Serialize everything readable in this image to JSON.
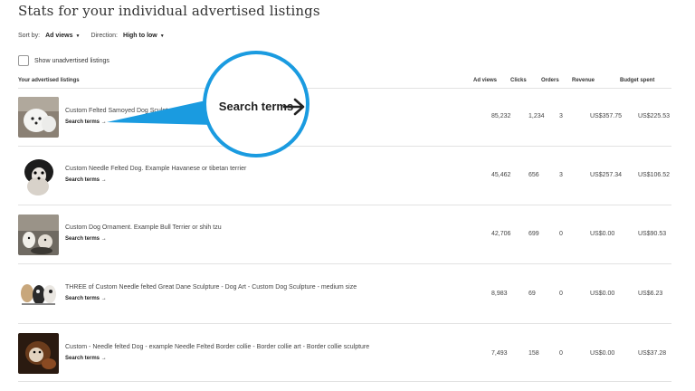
{
  "page": {
    "title": "Stats for your individual advertised listings"
  },
  "controls": {
    "sort_label": "Sort by:",
    "sort_value": "Ad views",
    "direction_label": "Direction:",
    "direction_value": "High to low",
    "show_unadvertised": "Show unadvertised listings"
  },
  "table": {
    "headers": {
      "listings": "Your advertised listings",
      "views": "Ad views",
      "clicks": "Clicks",
      "orders": "Orders",
      "revenue": "Revenue",
      "budget": "Budget spent"
    },
    "search_terms": "Search terms",
    "rows": [
      {
        "title": "Custom Felted Samoyed Dog Sculpture.",
        "views": "85,232",
        "clicks": "1,234",
        "orders": "3",
        "revenue": "US$357.75",
        "budget": "US$225.53"
      },
      {
        "title": "Custom Needle Felted Dog. Example Havanese or tibetan terrier",
        "views": "45,462",
        "clicks": "656",
        "orders": "3",
        "revenue": "US$257.34",
        "budget": "US$106.52"
      },
      {
        "title": "Custom Dog Ornament. Example Bull Terrier or shih tzu",
        "views": "42,706",
        "clicks": "699",
        "orders": "0",
        "revenue": "US$0.00",
        "budget": "US$90.53"
      },
      {
        "title": "THREE of Custom Needle felted Great Dane Sculpture - Dog Art - Custom Dog Sculpture - medium size",
        "views": "8,983",
        "clicks": "69",
        "orders": "0",
        "revenue": "US$0.00",
        "budget": "US$6.23"
      },
      {
        "title": "Custom - Needle felted Dog - example Needle Felted Border collie - Border collie art - Border collie sculpture",
        "views": "7,493",
        "clicks": "158",
        "orders": "0",
        "revenue": "US$0.00",
        "budget": "US$37.28"
      }
    ]
  },
  "callout": {
    "text": "Search terms",
    "color": "#1a9be0"
  },
  "icons": {
    "arrow": "arrow-right-icon",
    "caret": "caret-down-icon",
    "checkbox": "checkbox-icon"
  }
}
